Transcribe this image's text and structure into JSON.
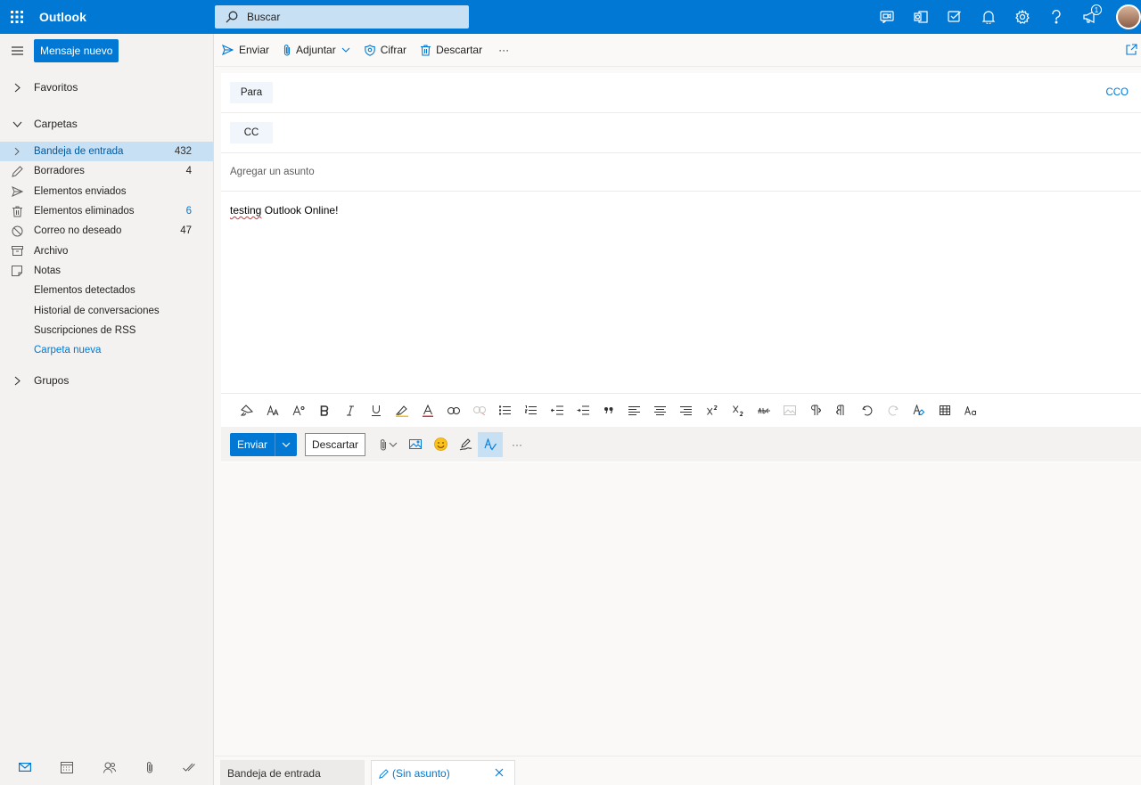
{
  "app": {
    "title": "Outlook"
  },
  "search": {
    "placeholder": "Buscar"
  },
  "notifications": {
    "badge": "1"
  },
  "left": {
    "new_message": "Mensaje nuevo",
    "favorites": "Favoritos",
    "folders_header": "Carpetas",
    "folders": [
      {
        "name": "Bandeja de entrada",
        "count": "432",
        "icon": "chevron-right-icon"
      },
      {
        "name": "Borradores",
        "count": "4",
        "icon": "pencil-icon"
      },
      {
        "name": "Elementos enviados",
        "count": "",
        "icon": "send-icon"
      },
      {
        "name": "Elementos eliminados",
        "count": "6",
        "icon": "trash-icon"
      },
      {
        "name": "Correo no deseado",
        "count": "47",
        "icon": "block-icon"
      },
      {
        "name": "Archivo",
        "count": "",
        "icon": "archive-icon"
      },
      {
        "name": "Notas",
        "count": "",
        "icon": "note-icon"
      },
      {
        "name": "Elementos detectados",
        "count": "",
        "icon": ""
      },
      {
        "name": "Historial de conversaciones",
        "count": "",
        "icon": ""
      },
      {
        "name": "Suscripciones de RSS",
        "count": "",
        "icon": ""
      },
      {
        "name": "Carpeta nueva",
        "count": "",
        "icon": ""
      }
    ],
    "groups": "Grupos"
  },
  "cmdbar": {
    "send": "Enviar",
    "attach": "Adjuntar",
    "encrypt": "Cifrar",
    "discard": "Descartar",
    "more": "···"
  },
  "compose": {
    "to": "Para",
    "cc": "CC",
    "bcc": "CCO",
    "subject_placeholder": "Agregar un asunto",
    "body_word1": "testing",
    "body_rest": " Outlook Online!",
    "send": "Enviar",
    "discard": "Descartar",
    "more": "···"
  },
  "tabs": {
    "inbox": "Bandeja de entrada",
    "draft": "(Sin asunto)"
  },
  "colors": {
    "accent": "#0078d4",
    "selected": "#c7e0f4"
  }
}
